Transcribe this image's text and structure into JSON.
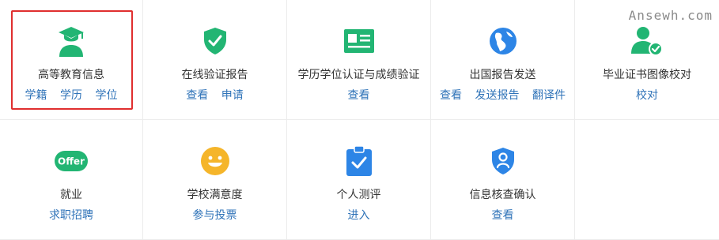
{
  "watermark": "Ansewh.com",
  "colors": {
    "accent_green": "#22b573",
    "link_blue": "#2f73b8",
    "highlight_red": "#e02f2f",
    "icon_blue": "#2d85e6",
    "icon_yellow": "#f5b52a"
  },
  "services": [
    {
      "title": "高等教育信息",
      "icon": "graduate-icon",
      "links": [
        "学籍",
        "学历",
        "学位"
      ]
    },
    {
      "title": "在线验证报告",
      "icon": "shield-check-icon",
      "links": [
        "查看",
        "申请"
      ]
    },
    {
      "title": "学历学位认证与成绩验证",
      "icon": "id-card-icon",
      "links": [
        "查看"
      ]
    },
    {
      "title": "出国报告发送",
      "icon": "globe-icon",
      "links": [
        "查看",
        "发送报告",
        "翻译件"
      ]
    },
    {
      "title": "毕业证书图像校对",
      "icon": "user-check-icon",
      "links": [
        "校对"
      ]
    },
    {
      "title": "就业",
      "icon": "offer-icon",
      "icon_text": "Offer",
      "links": [
        "求职招聘"
      ]
    },
    {
      "title": "学校满意度",
      "icon": "smiley-icon",
      "links": [
        "参与投票"
      ]
    },
    {
      "title": "个人测评",
      "icon": "clipboard-check-icon",
      "links": [
        "进入"
      ]
    },
    {
      "title": "信息核查确认",
      "icon": "shield-user-icon",
      "links": [
        "查看"
      ]
    }
  ]
}
